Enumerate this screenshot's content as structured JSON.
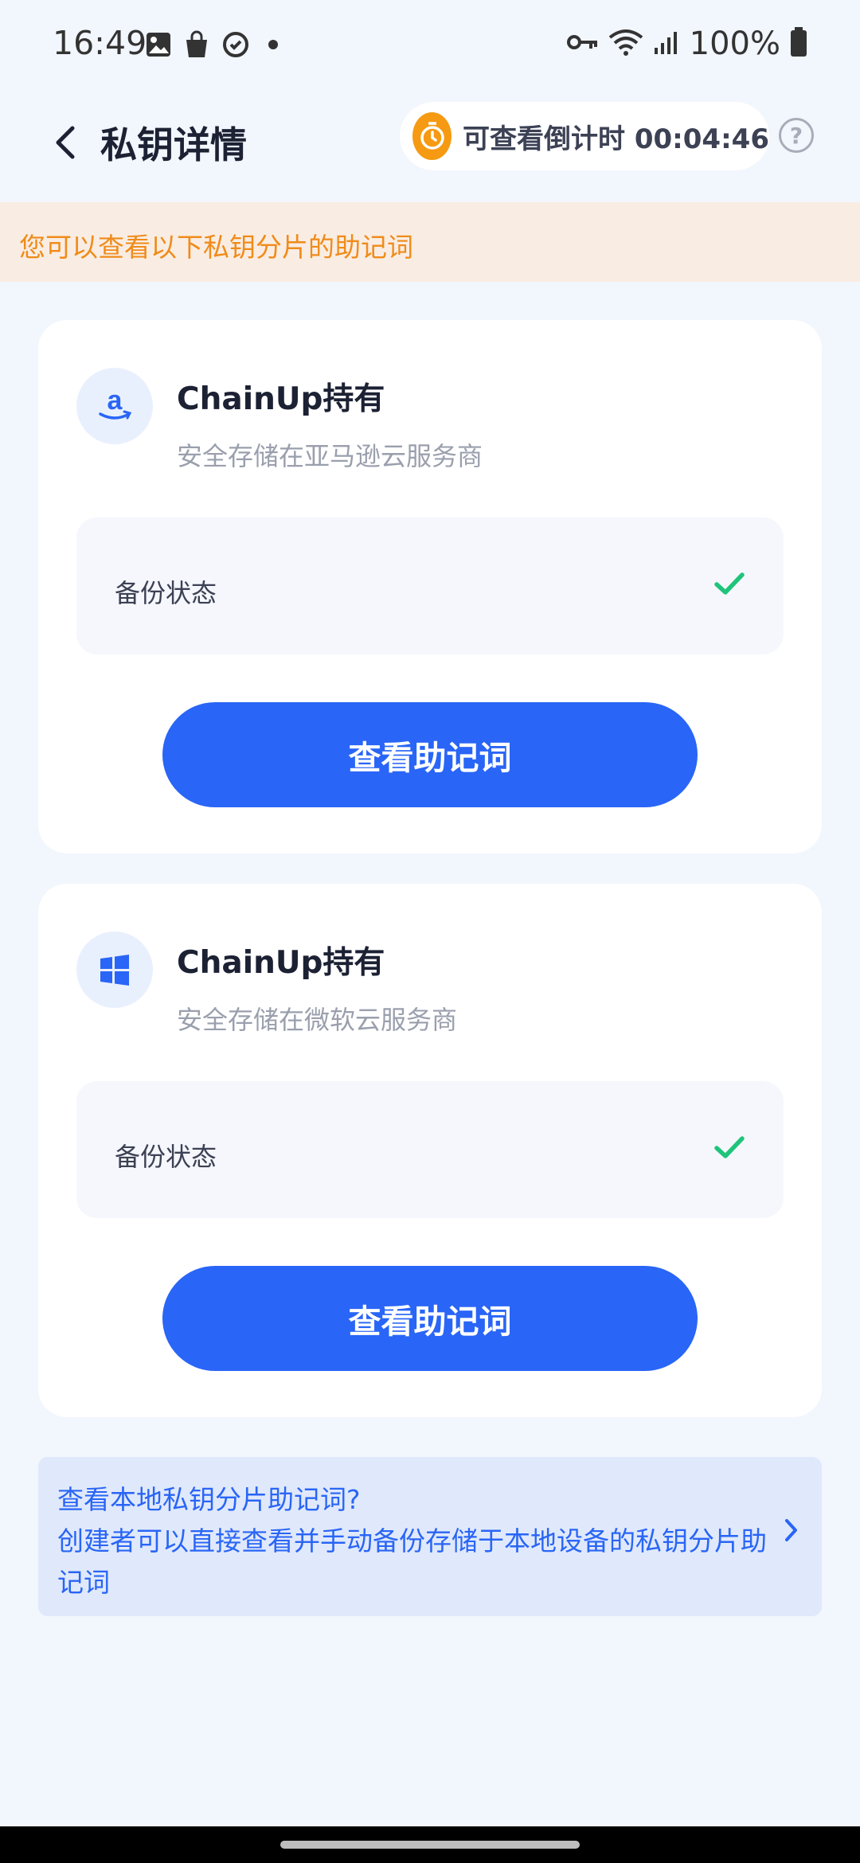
{
  "status_bar": {
    "time": "16:49",
    "left_icons": [
      "image-icon",
      "shopping-bag-icon",
      "sync-icon",
      "dot-icon"
    ],
    "right_icons": [
      "key-icon",
      "wifi-icon",
      "signal-icon",
      "battery-icon"
    ],
    "battery": "100%"
  },
  "header": {
    "title": "私钥详情",
    "countdown_label": "可查看倒计时 00:04:46",
    "help_symbol": "?"
  },
  "notice": {
    "text": "您可以查看以下私钥分片的助记词",
    "color": "#f08b1a",
    "background": "#f9ede3"
  },
  "cards": [
    {
      "icon": "amazon-icon",
      "title": "ChainUp持有",
      "subtitle": "安全存储在亚马逊云服务商",
      "backup_label": "备份状态",
      "backup_status": "check-icon",
      "button_label": "查看助记词"
    },
    {
      "icon": "windows-icon",
      "title": "ChainUp持有",
      "subtitle": "安全存储在微软云服务商",
      "backup_label": "备份状态",
      "backup_status": "check-icon",
      "button_label": "查看助记词"
    }
  ],
  "info_box": {
    "line1": "查看本地私钥分片助记词?",
    "line2": "创建者可以直接查看并手动备份存储于本地设备的私钥分片助记词"
  },
  "colors": {
    "accent": "#2965f6",
    "success": "#1fc47a",
    "timer": "#f59a12",
    "background": "#f2f6fd"
  }
}
